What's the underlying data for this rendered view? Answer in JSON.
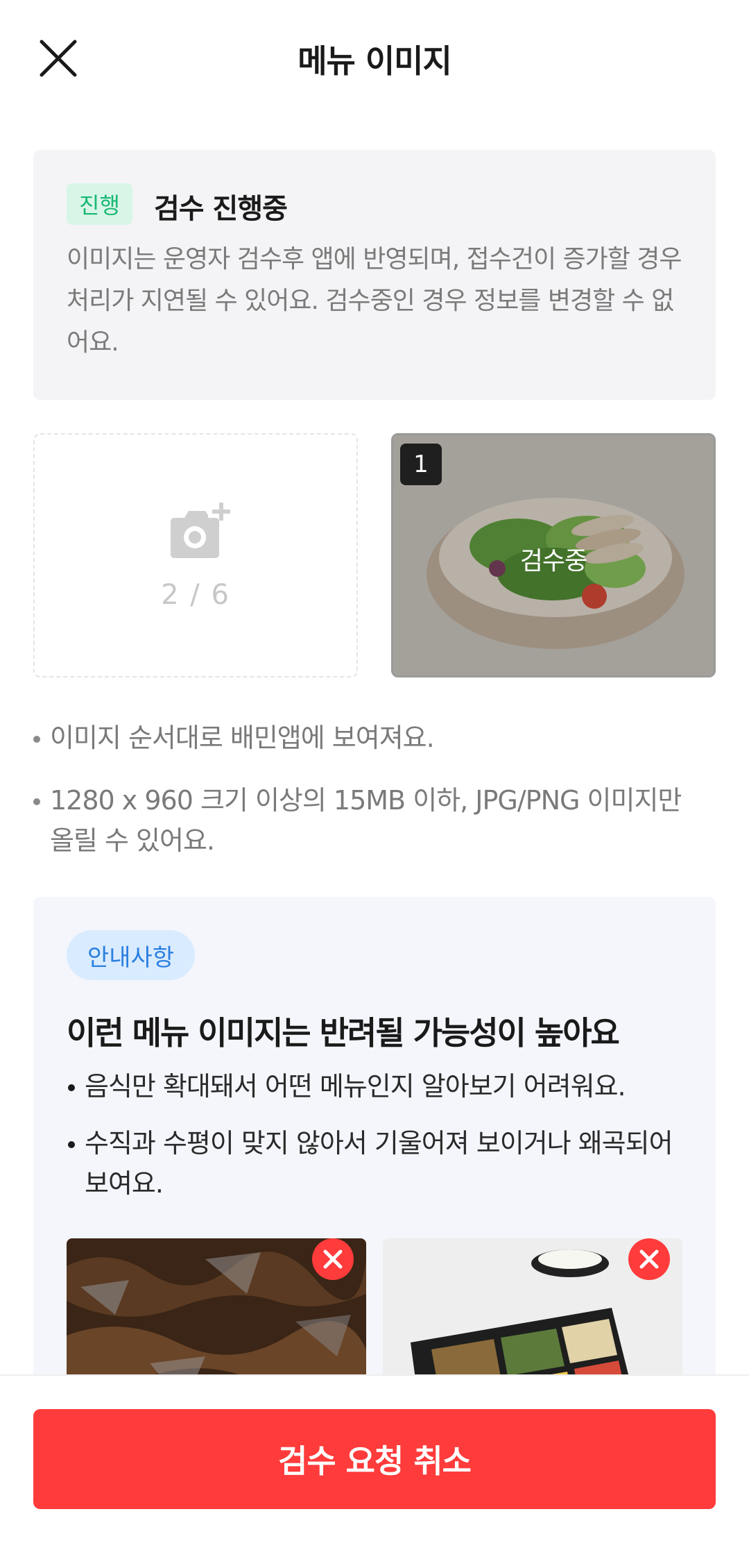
{
  "header": {
    "title": "메뉴 이미지",
    "close_icon": "close-icon"
  },
  "review_status": {
    "badge": "진행",
    "title": "검수 진행중",
    "description": "이미지는 운영자 검수후 앱에 반영되며, 접수건이 증가할 경우 처리가 지연될 수 있어요. 검수중인 경우 정보를 변경할 수 없어요.",
    "badge_color": "#17b873"
  },
  "images": {
    "upload_count": "2 / 6",
    "upload_icon": "camera-add-icon",
    "items": [
      {
        "number": "1",
        "status": "검수중"
      }
    ]
  },
  "rules": [
    "이미지 순서대로 배민앱에 보여져요.",
    "1280 x 960 크기 이상의 15MB 이하, JPG/PNG 이미지만 올릴 수 있어요."
  ],
  "notice": {
    "badge": "안내사항",
    "title": "이런 메뉴 이미지는 반려될 가능성이 높아요",
    "items": [
      "음식만 확대돼서 어떤 메뉴인지 알아보기 어려워요.",
      "수직과 수평이 맞지 않아서 기울어져 보이거나 왜곡되어 보여요."
    ],
    "reject_icon": "reject-x-icon",
    "badge_color": "#2b7fe0"
  },
  "footer": {
    "cancel_label": "검수 요청 취소",
    "button_color": "#ff3b3b"
  }
}
